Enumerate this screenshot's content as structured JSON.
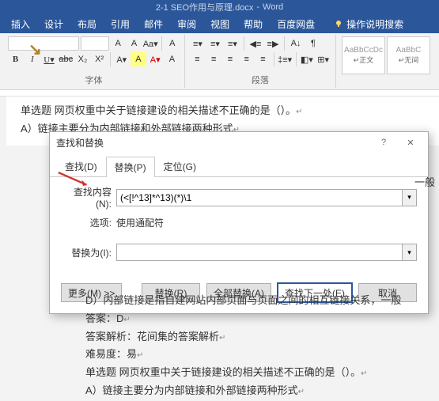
{
  "titlebar": {
    "doc": "2-1 SEO作用与原理.docx",
    "app": "Word"
  },
  "menubar": [
    "插入",
    "设计",
    "布局",
    "引用",
    "邮件",
    "审阅",
    "视图",
    "帮助",
    "百度网盘"
  ],
  "tell_me": "操作说明搜索",
  "ribbon": {
    "font": {
      "row1": [
        "A",
        "A",
        "Aa",
        "A"
      ],
      "row2": [
        "B",
        "I",
        "U",
        "abc",
        "X₂",
        "X²",
        "A",
        "A"
      ],
      "label": "字体"
    },
    "para": {
      "label": "段落"
    },
    "styles": [
      {
        "preview": "AaBbCcDc",
        "name": "↵正文"
      },
      {
        "preview": "AaBbC",
        "name": "↵无间"
      }
    ]
  },
  "doc": {
    "l1": "单选题    网页权重中关于链接建设的相关描述不正确的是（）。",
    "l2": "A）链接主要分为内部链接和外部链接两种形式",
    "l3": "D）内部链接是指自建网站内部页面与页面之间的相互链接关系，一般",
    "l4": "答案：D",
    "l5": "答案解析：花间集的答案解析",
    "l6": "难易度：易",
    "l7": "单选题    网页权重中关于链接建设的相关描述不正确的是（）。",
    "l8": "A）链接主要分为内部链接和外部链接两种形式",
    "peek": "一般"
  },
  "dialog": {
    "title": "查找和替换",
    "tabs": {
      "find": "查找(D)",
      "replace": "替换(P)",
      "goto": "定位(G)"
    },
    "find_label": "查找内容(N):",
    "find_value": "(<[!^13]*^13)(*)\\1",
    "options_label": "选项:",
    "options_value": "使用通配符",
    "replace_label": "替换为(I):",
    "replace_value": "",
    "buttons": {
      "more": "更多(M) >>",
      "replace": "替换(R)",
      "replace_all": "全部替换(A)",
      "find_next": "查找下一处(E)",
      "cancel": "取消"
    }
  }
}
